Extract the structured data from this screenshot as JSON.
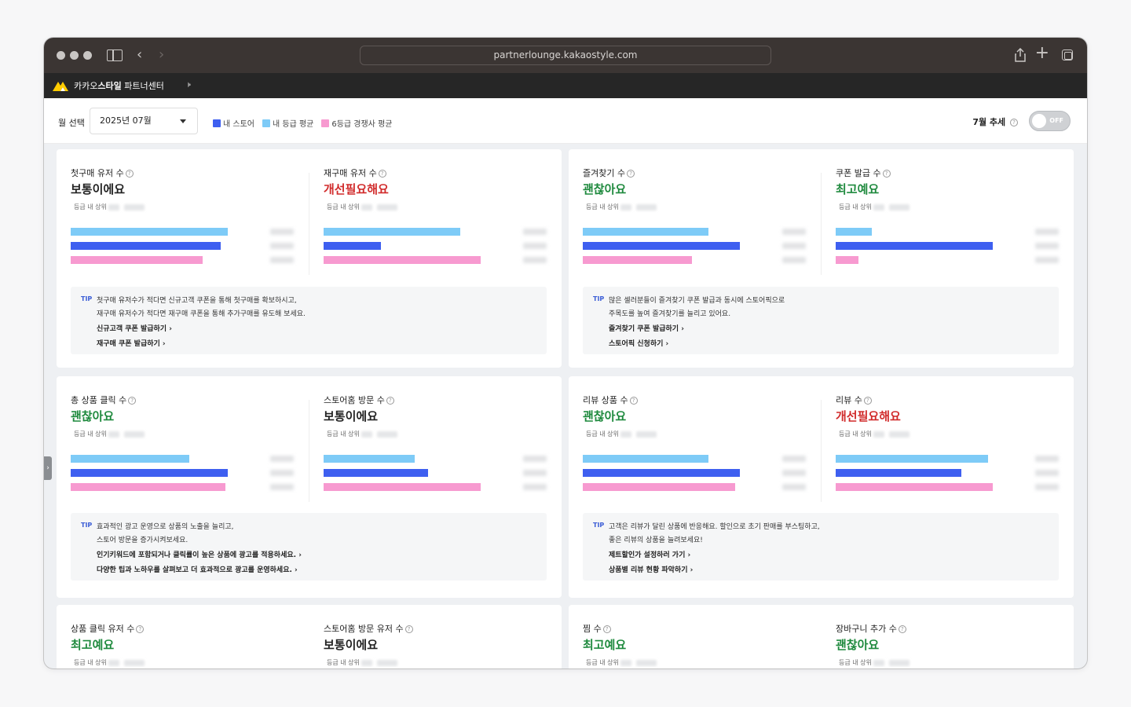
{
  "browser": {
    "url": "partnerlounge.kakaostyle.com"
  },
  "app": {
    "brand_prefix": "카카오",
    "brand_bold": "스타일",
    "brand_suffix": " 파트너센터"
  },
  "filter": {
    "month_label": "월 선택",
    "month_value": "2025년 07월",
    "legend": [
      {
        "label": "내 스토어",
        "color": "#3e5ff0"
      },
      {
        "label": "내 등급 평균",
        "color": "#7ecbf7"
      },
      {
        "label": "6등급 경쟁사 평균",
        "color": "#f79ad0"
      }
    ],
    "trend_label": "7월 추세",
    "toggle_text": "OFF"
  },
  "rank_prefix": "등급 내 상위",
  "cards": [
    {
      "metrics": [
        {
          "title": "첫구매 유저 수",
          "status": "보통이에요",
          "status_color": "black",
          "bars": [
            0.69,
            0.66,
            0.58
          ]
        },
        {
          "title": "재구매 유저 수",
          "status": "개선필요해요",
          "status_color": "red",
          "bars": [
            0.6,
            0.25,
            0.69
          ]
        }
      ],
      "tip": {
        "label": "TIP",
        "lines": [
          "첫구매 유저수가 적다면 신규고객 쿠폰을 통해 첫구매를 확보하시고,",
          "재구매 유저수가 적다면 재구매 쿠폰을 통해 추가구매를 유도해 보세요."
        ],
        "links": [
          "신규고객 쿠폰 발급하기 ›",
          "재구매 쿠폰 발급하기 ›"
        ]
      }
    },
    {
      "metrics": [
        {
          "title": "즐겨찾기 수",
          "status": "괜찮아요",
          "status_color": "green",
          "bars": [
            0.55,
            0.69,
            0.48
          ]
        },
        {
          "title": "쿠폰 발급 수",
          "status": "최고예요",
          "status_color": "green",
          "bars": [
            0.16,
            0.69,
            0.1
          ]
        }
      ],
      "tip": {
        "label": "TIP",
        "lines": [
          "많은 셀러분들이 즐겨찾기 쿠폰 발급과 동시에 스토어픽으로",
          "주목도를 높여 즐겨찾기를 늘리고 있어요."
        ],
        "links": [
          "즐겨찾기 쿠폰 발급하기 ›",
          "스토어픽 신청하기 ›"
        ]
      }
    },
    {
      "metrics": [
        {
          "title": "총 상품 클릭 수",
          "status": "괜찮아요",
          "status_color": "green",
          "bars": [
            0.52,
            0.69,
            0.68
          ]
        },
        {
          "title": "스토어홈 방문 수",
          "status": "보통이에요",
          "status_color": "black",
          "bars": [
            0.4,
            0.46,
            0.69
          ]
        }
      ],
      "tip": {
        "label": "TIP",
        "lines": [
          "효과적인 광고 운영으로 상품의 노출을 늘리고,",
          "스토어 방문을 증가시켜보세요."
        ],
        "links": [
          "인기키워드에 포함되거나 클릭률이 높은 상품에 광고를 적용하세요. ›",
          "다양한 팁과 노하우를 살펴보고 더 효과적으로 광고를 운영하세요. ›"
        ]
      }
    },
    {
      "metrics": [
        {
          "title": "리뷰 상품 수",
          "status": "괜찮아요",
          "status_color": "green",
          "bars": [
            0.55,
            0.69,
            0.67
          ]
        },
        {
          "title": "리뷰 수",
          "status": "개선필요해요",
          "status_color": "red",
          "bars": [
            0.67,
            0.55,
            0.69
          ]
        }
      ],
      "tip": {
        "label": "TIP",
        "lines": [
          "고객은 리뷰가 달린 상품에 반응해요. 할인으로 초기 판매를 부스팅하고,",
          "좋은 리뷰의 상품을 늘려보세요!"
        ],
        "links": [
          "제트할인가 설정하러 가기 ›",
          "상품별 리뷰 현황 파악하기 ›"
        ]
      }
    },
    {
      "metrics": [
        {
          "title": "상품 클릭 유저 수",
          "status": "최고예요",
          "status_color": "green",
          "bars": []
        },
        {
          "title": "스토어홈 방문 유저 수",
          "status": "보통이에요",
          "status_color": "black",
          "bars": []
        }
      ]
    },
    {
      "metrics": [
        {
          "title": "찜 수",
          "status": "최고예요",
          "status_color": "green",
          "bars": []
        },
        {
          "title": "장바구니 추가 수",
          "status": "괜찮아요",
          "status_color": "green",
          "bars": []
        }
      ]
    }
  ]
}
